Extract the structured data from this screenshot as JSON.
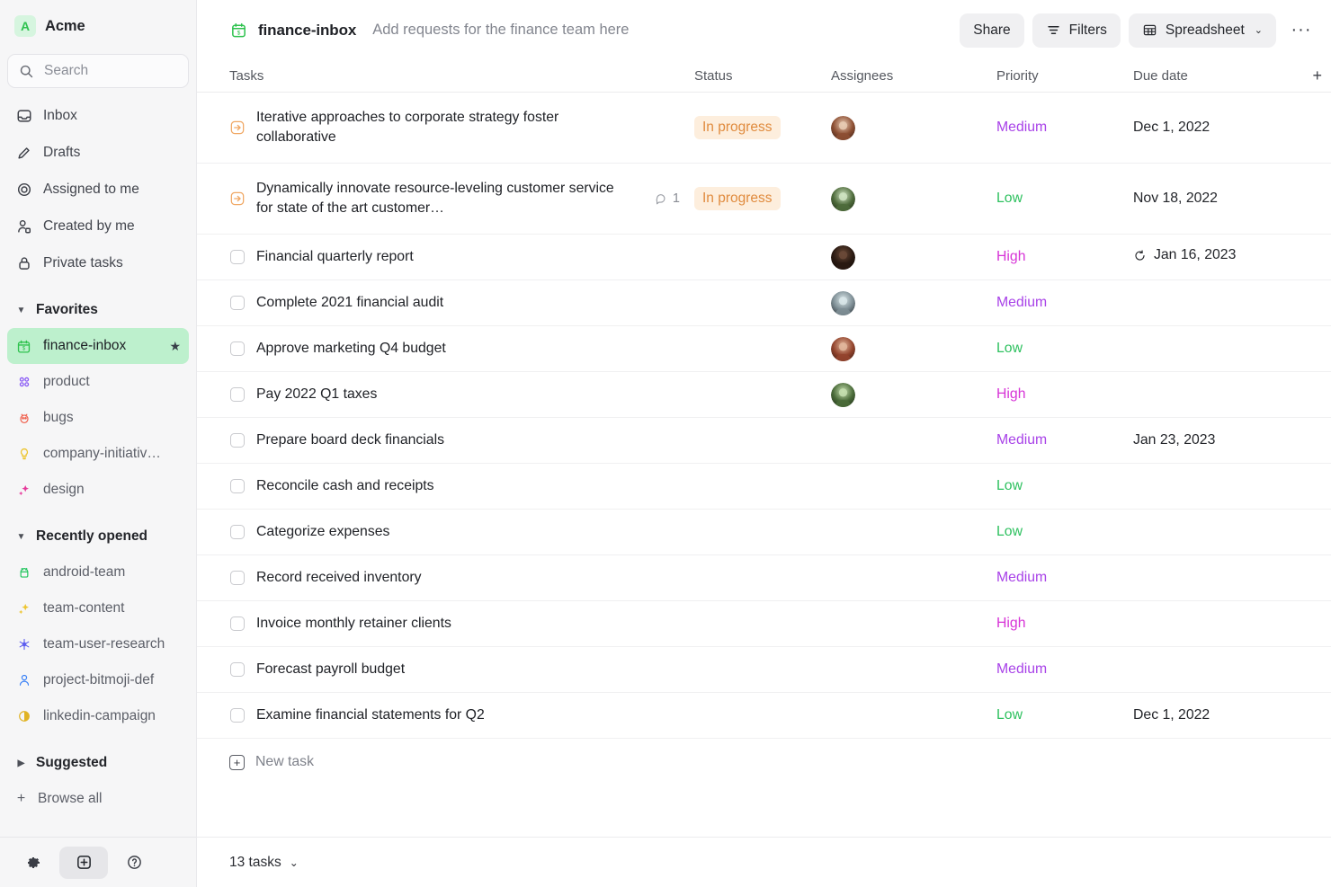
{
  "sidebar": {
    "workspace": {
      "badge_letter": "A",
      "name": "Acme",
      "badge_bg": "#d6f5df",
      "badge_fg": "#2ec24e"
    },
    "search": {
      "placeholder": "Search",
      "icon": "search-icon"
    },
    "nav": [
      {
        "label": "Inbox",
        "icon": "inbox-icon"
      },
      {
        "label": "Drafts",
        "icon": "pencil-icon"
      },
      {
        "label": "Assigned to me",
        "icon": "target-icon"
      },
      {
        "label": "Created by me",
        "icon": "person-gear-icon"
      },
      {
        "label": "Private tasks",
        "icon": "lock-icon"
      }
    ],
    "favorites": {
      "title": "Favorites",
      "expanded": true,
      "items": [
        {
          "label": "finance-inbox",
          "emoji": "🗓",
          "active": true,
          "starred": true
        },
        {
          "label": "product",
          "emoji": "⚫",
          "active": false,
          "starred": false
        },
        {
          "label": "bugs",
          "emoji": "🐞",
          "active": false,
          "starred": false
        },
        {
          "label": "company-initiativ…",
          "emoji": "💡",
          "active": false,
          "starred": false
        },
        {
          "label": "design",
          "emoji": "✨",
          "active": false,
          "starred": false
        }
      ]
    },
    "recently_opened": {
      "title": "Recently opened",
      "expanded": true,
      "items": [
        {
          "label": "android-team",
          "emoji": "🤖"
        },
        {
          "label": "team-content",
          "emoji": "✨"
        },
        {
          "label": "team-user-research",
          "emoji": "❄"
        },
        {
          "label": "project-bitmoji-def",
          "emoji": "👤"
        },
        {
          "label": "linkedin-campaign",
          "emoji": "◑"
        }
      ]
    },
    "suggested": {
      "title": "Suggested",
      "expanded": false
    },
    "browse_all": {
      "label": "Browse all",
      "icon": "plus-icon"
    },
    "footer": {
      "settings": {
        "name": "settings-button",
        "icon": "gear-icon"
      },
      "add": {
        "name": "add-button",
        "icon": "plus-square-icon"
      },
      "help": {
        "name": "help-button",
        "icon": "question-circle-icon"
      }
    }
  },
  "header": {
    "doc_icon": "calendar-icon",
    "title": "finance-inbox",
    "description": "Add requests for the finance team here",
    "share_label": "Share",
    "filters_label": "Filters",
    "view_label": "Spreadsheet",
    "more_label": "···"
  },
  "table": {
    "columns": [
      "Tasks",
      "Status",
      "Assignees",
      "Priority",
      "Due date"
    ],
    "add_column_label": "+",
    "rows": [
      {
        "title": "Iterative approaches to corporate strategy foster collaborative",
        "marker": "arrow",
        "status": "In progress",
        "assignee": "avatar-1",
        "priority": "Medium",
        "due": "Dec 1, 2022",
        "recurring": false,
        "comments": null,
        "tall": true
      },
      {
        "title": "Dynamically innovate resource-leveling customer service for state of the art customer…",
        "marker": "arrow",
        "status": "In progress",
        "assignee": "avatar-2",
        "priority": "Low",
        "due": "Nov 18, 2022",
        "recurring": false,
        "comments": "1",
        "tall": true
      },
      {
        "title": "Financial quarterly report",
        "marker": "checkbox",
        "status": "",
        "assignee": "avatar-3",
        "priority": "High",
        "due": "Jan 16, 2023",
        "recurring": true,
        "comments": null,
        "tall": false
      },
      {
        "title": "Complete 2021 financial audit",
        "marker": "checkbox",
        "status": "",
        "assignee": "avatar-4",
        "priority": "Medium",
        "due": "",
        "recurring": false,
        "comments": null,
        "tall": false
      },
      {
        "title": "Approve marketing Q4 budget",
        "marker": "checkbox",
        "status": "",
        "assignee": "avatar-5",
        "priority": "Low",
        "due": "",
        "recurring": false,
        "comments": null,
        "tall": false
      },
      {
        "title": "Pay 2022 Q1 taxes",
        "marker": "checkbox",
        "status": "",
        "assignee": "avatar-6",
        "priority": "High",
        "due": "",
        "recurring": false,
        "comments": null,
        "tall": false
      },
      {
        "title": "Prepare board deck financials",
        "marker": "checkbox",
        "status": "",
        "assignee": "",
        "priority": "Medium",
        "due": "Jan 23, 2023",
        "recurring": false,
        "comments": null,
        "tall": false
      },
      {
        "title": "Reconcile cash and receipts",
        "marker": "checkbox",
        "status": "",
        "assignee": "",
        "priority": "Low",
        "due": "",
        "recurring": false,
        "comments": null,
        "tall": false
      },
      {
        "title": "Categorize expenses",
        "marker": "checkbox",
        "status": "",
        "assignee": "",
        "priority": "Low",
        "due": "",
        "recurring": false,
        "comments": null,
        "tall": false
      },
      {
        "title": "Record received inventory",
        "marker": "checkbox",
        "status": "",
        "assignee": "",
        "priority": "Medium",
        "due": "",
        "recurring": false,
        "comments": null,
        "tall": false
      },
      {
        "title": "Invoice monthly retainer clients",
        "marker": "checkbox",
        "status": "",
        "assignee": "",
        "priority": "High",
        "due": "",
        "recurring": false,
        "comments": null,
        "tall": false
      },
      {
        "title": "Forecast payroll budget",
        "marker": "checkbox",
        "status": "",
        "assignee": "",
        "priority": "Medium",
        "due": "",
        "recurring": false,
        "comments": null,
        "tall": false
      },
      {
        "title": "Examine financial statements for Q2",
        "marker": "checkbox",
        "status": "",
        "assignee": "",
        "priority": "Low",
        "due": "Dec 1, 2022",
        "recurring": false,
        "comments": null,
        "tall": false
      }
    ],
    "new_task_label": "New task"
  },
  "footer": {
    "count_label": "13 tasks"
  },
  "colors": {
    "priority_medium": "#a842e8",
    "priority_low": "#2ec15f",
    "priority_high": "#d734d7",
    "status_in_progress_bg": "#fdeedd",
    "status_in_progress_fg": "#e08b3e",
    "active_favorite_bg": "#bdf0cd",
    "sidebar_bg": "#f6f6f7"
  }
}
